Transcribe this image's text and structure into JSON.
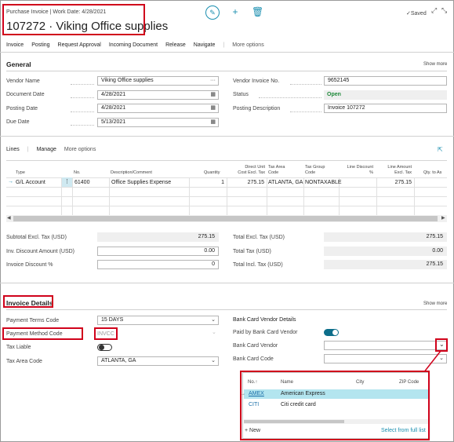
{
  "header": {
    "breadcrumb": "Purchase Invoice | Work Date: 4/28/2021",
    "title": "107272 · Viking Office supplies",
    "saved_label": "✓Saved",
    "edit_icon": "pencil-icon",
    "add_icon": "plus-icon",
    "delete_icon": "trash-icon"
  },
  "menu": {
    "items": [
      "Invoice",
      "Posting",
      "Request Approval",
      "Incoming Document",
      "Release",
      "Navigate"
    ],
    "more": "More options"
  },
  "general": {
    "title": "General",
    "show_more": "Show more",
    "vendor_name_label": "Vendor Name",
    "vendor_name": "Viking Office supplies",
    "document_date_label": "Document Date",
    "document_date": "4/28/2021",
    "posting_date_label": "Posting Date",
    "posting_date": "4/28/2021",
    "due_date_label": "Due Date",
    "due_date": "5/13/2021",
    "vendor_invoice_no_label": "Vendor Invoice No.",
    "vendor_invoice_no": "9652145",
    "status_label": "Status",
    "status": "Open",
    "posting_description_label": "Posting Description",
    "posting_description": "Invoice 107272"
  },
  "lines": {
    "tab_lines": "Lines",
    "tab_manage": "Manage",
    "tab_more": "More options",
    "columns": {
      "type": "Type",
      "no": "No.",
      "description": "Description/Comment",
      "quantity": "Quantity",
      "unit_cost_1": "Direct Unit",
      "unit_cost_2": "Cost Excl. Tax",
      "tax_area_1": "Tax Area",
      "tax_area_2": "Code",
      "tax_group_1": "Tax Group",
      "tax_group_2": "Code",
      "line_discount_1": "Line Discount",
      "line_discount_2": "%",
      "line_amount_1": "Line Amount",
      "line_amount_2": "Excl. Tax",
      "qty_to_assign": "Qty. to As"
    },
    "row": {
      "type": "G/L Account",
      "no": "61400",
      "description": "Office Supplies Expense",
      "quantity": "1",
      "unit_cost": "275.15",
      "tax_area": "ATLANTA, GA",
      "tax_group": "NONTAXABLE",
      "line_amount": "275.15"
    }
  },
  "totals": {
    "subtotal_label": "Subtotal Excl. Tax (USD)",
    "subtotal": "275.15",
    "inv_discount_label": "Inv. Discount Amount (USD)",
    "inv_discount": "0.00",
    "invoice_discount_pct_label": "Invoice Discount %",
    "invoice_discount_pct": "0",
    "total_excl_label": "Total Excl. Tax (USD)",
    "total_excl": "275.15",
    "total_tax_label": "Total Tax (USD)",
    "total_tax": "0.00",
    "total_incl_label": "Total Incl. Tax (USD)",
    "total_incl": "275.15"
  },
  "invoice_details": {
    "title": "Invoice Details",
    "show_more": "Show more",
    "payment_terms_label": "Payment Terms Code",
    "payment_terms": "15 DAYS",
    "payment_method_label": "Payment Method Code",
    "payment_method": "INVCC",
    "tax_liable_label": "Tax Liable",
    "tax_area_label": "Tax Area Code",
    "tax_area": "ATLANTA, GA",
    "bank_card_heading": "Bank Card Vendor Details",
    "paid_by_bank_card_label": "Paid by Bank Card Vendor",
    "bank_card_vendor_label": "Bank Card Vendor",
    "bank_card_code_label": "Bank Card Code"
  },
  "lookup": {
    "col_no": "No.↑",
    "col_name": "Name",
    "col_city": "City",
    "col_zip": "ZIP Code",
    "rows": [
      {
        "no": "AMEX",
        "name": "American Express"
      },
      {
        "no": "CITI",
        "name": "Citi credit card"
      }
    ],
    "new_label": "+ New",
    "select_full_list": "Select from full list"
  },
  "colors": {
    "accent": "#1b8fb0",
    "status_open": "#1f8a3a",
    "highlight": "#d0021b",
    "selected_row": "#b3e5ef",
    "toggle_on": "#0d6e8a"
  }
}
